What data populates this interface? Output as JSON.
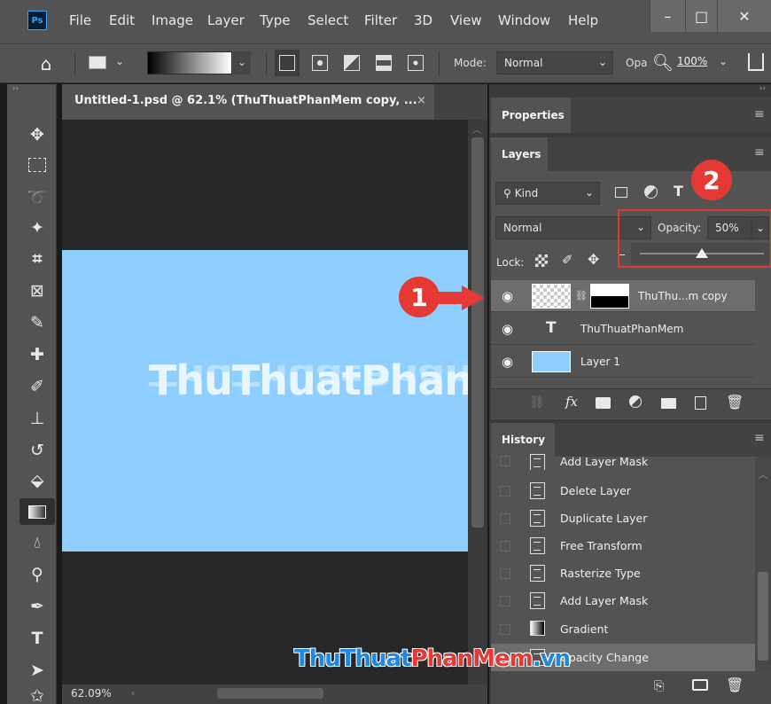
{
  "app": {
    "logo": "Ps",
    "menu": [
      "File",
      "Edit",
      "Image",
      "Layer",
      "Type",
      "Select",
      "Filter",
      "3D",
      "View",
      "Window",
      "Help"
    ],
    "window_controls": [
      "–",
      "□",
      "✕"
    ]
  },
  "options_bar": {
    "mode_label": "Mode:",
    "mode_value": "Normal",
    "opacity_label": "Opa",
    "zoom_value": "100%"
  },
  "document": {
    "tab_title": "Untitled-1.psd @ 62.1% (ThuThuatPhanMem copy, ...",
    "close_glyph": "×",
    "canvas_text": "ThuThuatPhanM",
    "canvas_color": "#8ecfff",
    "zoom_status": "62.09%"
  },
  "panels": {
    "properties_tab": "Properties",
    "layers_tab": "Layers",
    "filter_kind": "Kind",
    "blend_mode": "Normal",
    "opacity_label": "Opacity:",
    "opacity_value": "50%",
    "opacity_slider_level": 0.5,
    "lock_label": "Lock:",
    "layers": [
      {
        "name": "ThuThu...m copy",
        "type": "mask",
        "selected": true
      },
      {
        "name": "ThuThuatPhanMem",
        "type": "text",
        "selected": false
      },
      {
        "name": "Layer 1",
        "type": "fill",
        "selected": false
      }
    ],
    "history_tab": "History",
    "history": [
      "Add Layer Mask",
      "Delete Layer",
      "Duplicate Layer",
      "Free Transform",
      "Rasterize Type",
      "Add Layer Mask",
      "Gradient",
      "Opacity Change"
    ]
  },
  "callouts": [
    "1",
    "2"
  ],
  "watermark": {
    "part1": "ThuThuat",
    "part2": "PhanMem",
    "part3": ".vn",
    "colors": {
      "part1": "#1e88e5",
      "part2": "#e53935",
      "part3": "#1e88e5"
    }
  }
}
